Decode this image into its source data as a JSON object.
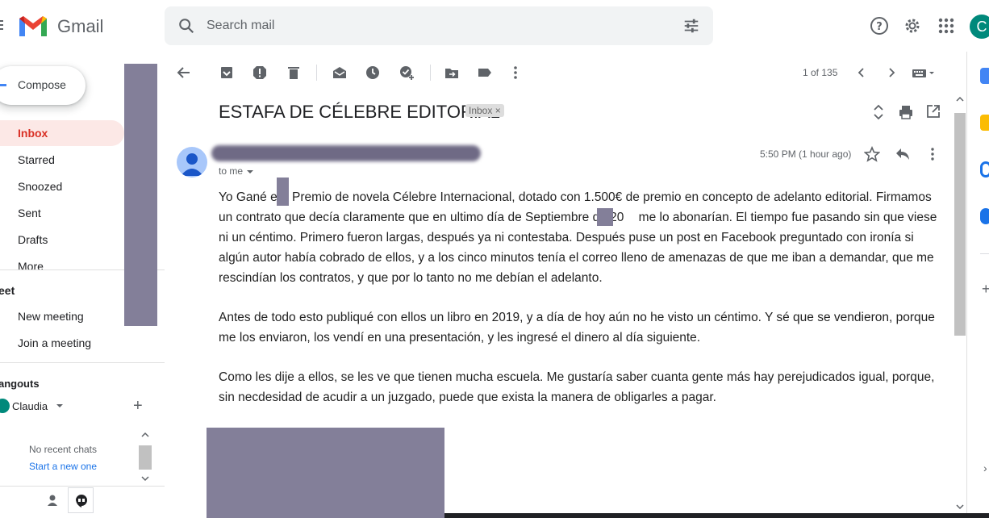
{
  "app": {
    "brand": "Gmail",
    "avatar_initial": "C"
  },
  "search": {
    "placeholder": "Search mail"
  },
  "sidebar": {
    "compose_label": "Compose",
    "items": [
      {
        "label": "Inbox",
        "active": true
      },
      {
        "label": "Starred"
      },
      {
        "label": "Snoozed"
      },
      {
        "label": "Sent"
      },
      {
        "label": "Drafts"
      },
      {
        "label": "More"
      }
    ],
    "meet": {
      "title": "eet",
      "items": [
        {
          "label": "New meeting"
        },
        {
          "label": "Join a meeting"
        }
      ]
    },
    "hangouts": {
      "title": "angouts",
      "user": "Claudia",
      "no_chats": "No recent chats",
      "start_new": "Start a new one"
    }
  },
  "toolbar": {
    "count": "1 of 135"
  },
  "email": {
    "subject": "ESTAFA DE CÉLEBRE EDITORIAL",
    "label": "Inbox",
    "to": "to me",
    "time": "5:50 PM (1 hour ago)",
    "p1_a": "Yo Gané e",
    "p1_b": " Premio de novela Célebre Internacional, dotado con 1.500€ de premio en concepto de adelanto editorial. Firmamos un contrato que decía claramente que en ultimo día de Septiembre de 20",
    "p1_c": " me lo abonarían. El tiempo fue pasando sin que viese ni un céntimo. Primero fueron largas, después ya ni contestaba. Después puse un post en Facebook preguntado con ironía si algún autor había cobrado de ellos, y a los cinco minutos tenía el correo lleno de amenazas de que me iban a demandar, que me rescindían los contratos, y que por lo tanto no me debían el adelanto.",
    "p2": "Antes de todo esto publiqué con ellos un libro en 2019, y a día de hoy aún no he visto un céntimo. Y sé que se vendieron, porque me los enviaron, los vendí en una presentación, y les ingresé el dinero al día siguiente.",
    "p3": "Como les dije a ellos, se les ve que tienen mucha escuela. Me gustaría saber cuanta gente más hay perejudicados igual, porque, sin necdesidad de acudir a un juzgado, puede que exista la manera de obligarles a pagar."
  },
  "colors": {
    "accent_red": "#d93025",
    "active_bg": "#fce8e6",
    "redaction": "#837f99",
    "link_blue": "#1a73e8"
  }
}
